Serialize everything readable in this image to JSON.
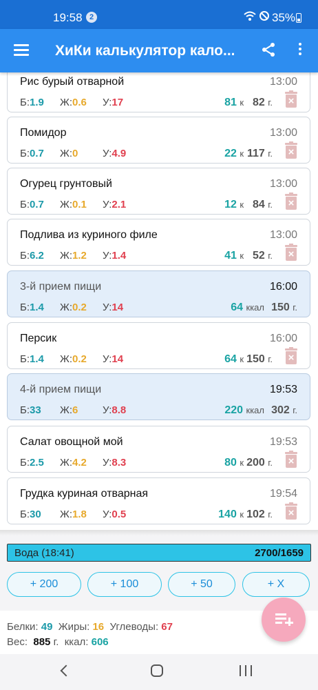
{
  "status_bar": {
    "time": "19:58",
    "notification_count": "2",
    "battery": "35%"
  },
  "app_bar": {
    "title": "ХиКи калькулятор кало..."
  },
  "labels": {
    "protein": "Б:",
    "fat": "Ж:",
    "carbs": "У:",
    "kcal_short": "к",
    "kcal_long": "ккал",
    "gram": "г."
  },
  "entries": [
    {
      "type": "food",
      "name": "Рис бурый отварной",
      "time": "13:00",
      "protein": "1.9",
      "fat": "0.6",
      "carbs": "17",
      "kcal": "81",
      "grams": "82"
    },
    {
      "type": "food",
      "name": "Помидор",
      "time": "13:00",
      "protein": "0.7",
      "fat": "0",
      "carbs": "4.9",
      "kcal": "22",
      "grams": "117"
    },
    {
      "type": "food",
      "name": "Огурец грунтовый",
      "time": "13:00",
      "protein": "0.7",
      "fat": "0.1",
      "carbs": "2.1",
      "kcal": "12",
      "grams": "84"
    },
    {
      "type": "food",
      "name": "Подлива из куриного филе",
      "time": "13:00",
      "protein": "6.2",
      "fat": "1.2",
      "carbs": "1.4",
      "kcal": "41",
      "grams": "52"
    },
    {
      "type": "meal",
      "name": "3-й прием пищи",
      "time": "16:00",
      "protein": "1.4",
      "fat": "0.2",
      "carbs": "14",
      "kcal": "64",
      "grams": "150"
    },
    {
      "type": "food",
      "name": "Персик",
      "time": "16:00",
      "protein": "1.4",
      "fat": "0.2",
      "carbs": "14",
      "kcal": "64",
      "grams": "150"
    },
    {
      "type": "meal",
      "name": "4-й прием пищи",
      "time": "19:53",
      "protein": "33",
      "fat": "6",
      "carbs": "8.8",
      "kcal": "220",
      "grams": "302"
    },
    {
      "type": "food",
      "name": "Салат овощной мой",
      "time": "19:53",
      "protein": "2.5",
      "fat": "4.2",
      "carbs": "8.3",
      "kcal": "80",
      "grams": "200"
    },
    {
      "type": "food",
      "name": "Грудка куриная отварная",
      "time": "19:54",
      "protein": "30",
      "fat": "1.8",
      "carbs": "0.5",
      "kcal": "140",
      "grams": "102"
    }
  ],
  "water": {
    "label": "Вода (18:41)",
    "value": "2700/1659",
    "buttons": [
      "+ 200",
      "+ 100",
      "+ 50",
      "+ X"
    ]
  },
  "summary": {
    "protein_label": "Белки:",
    "protein": "49",
    "fat_label": "Жиры:",
    "fat": "16",
    "carbs_label": "Углеводы:",
    "carbs": "67",
    "weight_label": "Вес:",
    "weight": "885",
    "weight_unit": "г.",
    "kcal_label": "ккал:",
    "kcal": "606"
  },
  "colors": {
    "app_bar": "#2d8df0",
    "status_bar": "#1a6fd3",
    "protein": "#1c9aa9",
    "fat": "#e7a92c",
    "carbs": "#e0404f",
    "kcal": "#19a3a3",
    "water": "#2dc3e6",
    "fab": "#f6a9bd"
  },
  "icons": {
    "menu": "hamburger-icon",
    "share": "share-icon",
    "more": "more-vert-icon",
    "delete": "trash-icon",
    "add_entry": "playlist-add-icon"
  }
}
